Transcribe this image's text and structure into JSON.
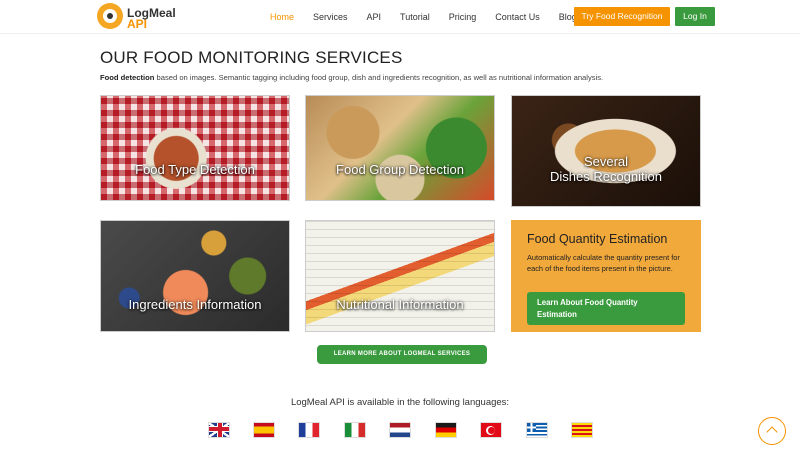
{
  "header": {
    "logo_line1": "LogMeal",
    "logo_line2": "API",
    "nav": [
      "Home",
      "Services",
      "API",
      "Tutorial",
      "Pricing",
      "Contact Us",
      "Blog"
    ],
    "try_button": "Try Food Recognition",
    "login_button": "Log In"
  },
  "main": {
    "title": "OUR FOOD MONITORING SERVICES",
    "subtitle_bold": "Food detection",
    "subtitle_rest": " based on images. Semantic tagging including food group, dish and ingredients recognition, as well as nutritional information analysis.",
    "cards": {
      "food_type": "Food Type Detection",
      "food_group": "Food Group Detection",
      "several_line1": "Several",
      "several_line2": "Dishes Recognition",
      "ingredients": "Ingredients Information",
      "nutritional": "Nutritional Information",
      "quantity_title": "Food Quantity Estimation",
      "quantity_text": "Automatically calculate the quantity present for each of the food items present in the picture.",
      "quantity_button": "Learn About Food Quantity Estimation"
    },
    "learn_more_button": "LEARN MORE ABOUT LOGMEAL SERVICES",
    "languages_title": "LogMeal API is available in the following languages:"
  },
  "colors": {
    "accent_orange": "#f59300",
    "accent_green": "#3a9a3e",
    "quantity_card_bg": "#f2a93b"
  },
  "icons": [
    "logo-icon",
    "flag-uk-icon",
    "flag-spain-icon",
    "flag-france-icon",
    "flag-italy-icon",
    "flag-netherlands-icon",
    "flag-germany-icon",
    "flag-turkey-icon",
    "flag-greece-icon",
    "flag-catalonia-icon",
    "scroll-top-icon"
  ]
}
